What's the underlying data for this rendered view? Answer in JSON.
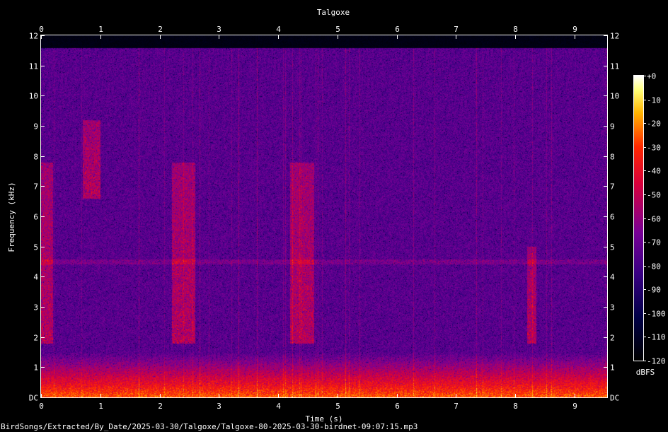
{
  "chart_data": {
    "type": "heatmap",
    "title": "Talgoxe",
    "xlabel": "Time (s)",
    "ylabel": "Frequency (kHz)",
    "xlim": [
      0,
      9.55
    ],
    "ylim": [
      0,
      12
    ],
    "x_ticks": [
      "0",
      "1",
      "2",
      "3",
      "4",
      "5",
      "6",
      "7",
      "8",
      "9"
    ],
    "y_ticks": [
      "DC",
      "1",
      "2",
      "3",
      "4",
      "5",
      "6",
      "7",
      "8",
      "9",
      "10",
      "11",
      "12"
    ],
    "colorbar": {
      "label": "dBFS",
      "range": [
        -120,
        0
      ],
      "ticks": [
        "+0",
        "-10",
        "-20",
        "-30",
        "-40",
        "-50",
        "-60",
        "-70",
        "-80",
        "-90",
        "-100",
        "-110",
        "-120"
      ]
    },
    "features": [
      {
        "t_start": 0.0,
        "t_end": 0.2,
        "f_low": 1.8,
        "f_high": 7.8
      },
      {
        "t_start": 0.7,
        "t_end": 1.0,
        "f_low": 6.6,
        "f_high": 9.2
      },
      {
        "t_start": 2.2,
        "t_end": 2.6,
        "f_low": 1.8,
        "f_high": 7.8
      },
      {
        "t_start": 4.2,
        "t_end": 4.6,
        "f_low": 1.8,
        "f_high": 7.8
      },
      {
        "t_start": 8.2,
        "t_end": 8.35,
        "f_low": 1.8,
        "f_high": 5.0
      }
    ],
    "hum_band_khz": 4.5,
    "noise_floor_khz": 1.5,
    "content_cutoff_khz": 11.6
  },
  "footer": {
    "file_path": "BirdSongs/Extracted/By_Date/2025-03-30/Talgoxe/Talgoxe-80-2025-03-30-birdnet-09:07:15.mp3"
  }
}
